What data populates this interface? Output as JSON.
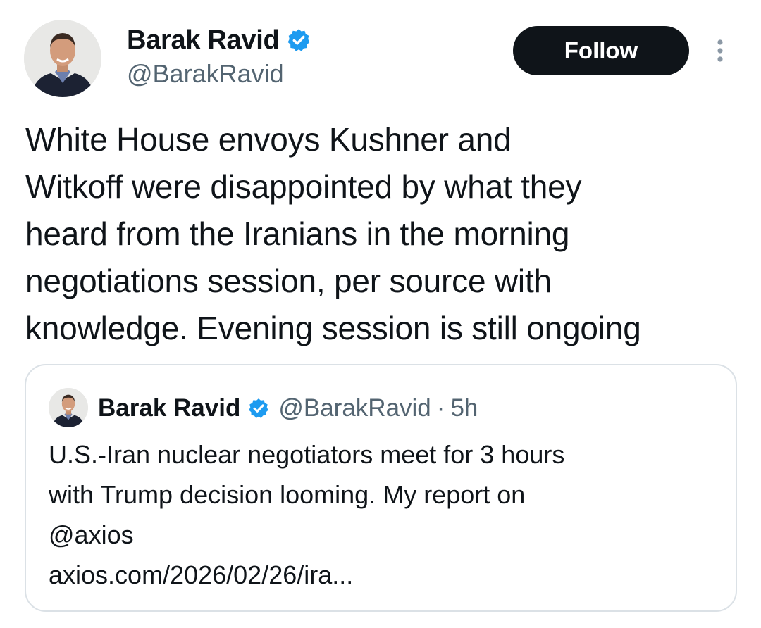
{
  "author": {
    "display_name": "Barak Ravid",
    "handle": "@BarakRavid",
    "verified": true
  },
  "follow_button": {
    "label": "Follow"
  },
  "tweet": {
    "text": "White House envoys Kushner and\nWitkoff were disappointed by what they\nheard from the Iranians in the morning\nnegotiations session, per source with\nknowledge. Evening session is still ongoing"
  },
  "quoted_tweet": {
    "display_name": "Barak Ravid",
    "handle": "@BarakRavid",
    "separator": "·",
    "time": "5h",
    "text": "U.S.-Iran nuclear negotiators meet for 3 hours\nwith Trump decision looming. My report on\n@axios",
    "link": "axios.com/2026/02/26/ira..."
  },
  "colors": {
    "text": "#0f1419",
    "secondary": "#536471",
    "verified_blue": "#1d9bf0",
    "button_bg": "#0f1419",
    "border": "#dbe1e6"
  },
  "icons": {
    "verified": "verified-badge-icon",
    "more": "more-vertical-icon"
  }
}
